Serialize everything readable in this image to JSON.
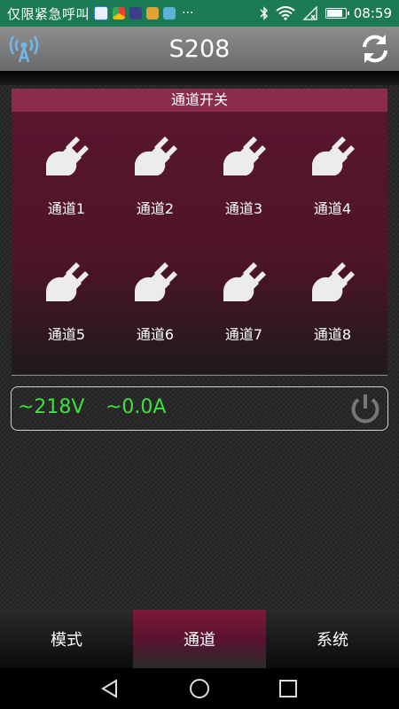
{
  "status_bar": {
    "carrier_text": "仅限紧急呼叫",
    "overflow": "···",
    "time": "08:59",
    "battery_level": 0.9,
    "icons": [
      "app-icon-qq",
      "app-icon-browser",
      "app-icon-store",
      "app-icon-wallet",
      "app-icon-game",
      "bluetooth-icon",
      "wifi-icon",
      "no-signal-icon",
      "battery-icon"
    ]
  },
  "header": {
    "title": "S208",
    "left_icon": "wifi-broadcast-icon",
    "right_icon": "refresh-icon"
  },
  "panel": {
    "title": "通道开关",
    "channels": [
      {
        "label": "通道1",
        "icon": "plug-icon"
      },
      {
        "label": "通道2",
        "icon": "plug-icon"
      },
      {
        "label": "通道3",
        "icon": "plug-icon"
      },
      {
        "label": "通道4",
        "icon": "plug-icon"
      },
      {
        "label": "通道5",
        "icon": "plug-icon"
      },
      {
        "label": "通道6",
        "icon": "plug-icon"
      },
      {
        "label": "通道7",
        "icon": "plug-icon"
      },
      {
        "label": "通道8",
        "icon": "plug-icon"
      }
    ]
  },
  "meter": {
    "voltage": "~218V",
    "current": "~0.0A",
    "power_icon": "power-icon"
  },
  "tabs": [
    {
      "label": "模式",
      "active": false
    },
    {
      "label": "通道",
      "active": true
    },
    {
      "label": "系统",
      "active": false
    }
  ],
  "colors": {
    "status_bar": "#1c7a55",
    "accent": "#8a2d4b",
    "meter_text": "#3ee03e"
  }
}
